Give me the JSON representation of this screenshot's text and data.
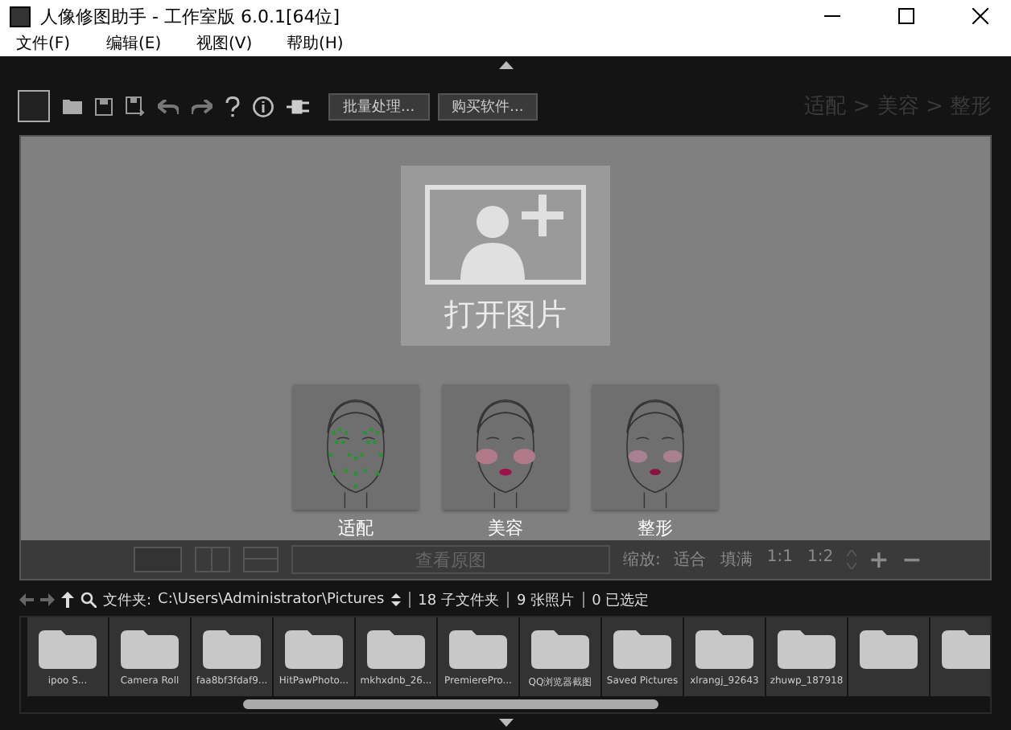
{
  "window": {
    "title": "人像修图助手 - 工作室版 6.0.1[64位]"
  },
  "menu": [
    "文件(F)",
    "编辑(E)",
    "视图(V)",
    "帮助(H)"
  ],
  "toolbar": {
    "buttons": [
      "批量处理...",
      "购买软件..."
    ],
    "breadcrumb": "适配 > 美容 > 整形"
  },
  "open_image": {
    "label": "打开图片"
  },
  "modes": [
    {
      "label": "适配",
      "kind": "landmarks"
    },
    {
      "label": "美容",
      "kind": "makeup"
    },
    {
      "label": "整形",
      "kind": "shape"
    }
  ],
  "view_bar": {
    "compare_button": "查看原图",
    "zoom_label": "缩放:",
    "zoom_options": [
      "适合",
      "填满",
      "1:1",
      "1:2"
    ],
    "zoom_in": "+",
    "zoom_out": "−"
  },
  "path_bar": {
    "folder_label": "文件夹:",
    "path": "C:\\Users\\Administrator\\Pictures",
    "subfolders": "18 子文件夹",
    "photos": "9 张照片",
    "selected": "0 已选定"
  },
  "folders": [
    {
      "kind": "folder",
      "label": "ipoo S..."
    },
    {
      "kind": "folder",
      "label": "Camera Roll"
    },
    {
      "kind": "folder",
      "label": "faa8bf3fdaf9..."
    },
    {
      "kind": "folder",
      "label": "HitPawPhoto..."
    },
    {
      "kind": "folder",
      "label": "mkhxdnb_26..."
    },
    {
      "kind": "folder",
      "label": "PremierePro..."
    },
    {
      "kind": "folder",
      "label": "QQ浏览器截图"
    },
    {
      "kind": "folder",
      "label": "Saved Pictures"
    },
    {
      "kind": "folder",
      "label": "xlrangj_92643"
    },
    {
      "kind": "folder",
      "label": "zhuwp_187918"
    },
    {
      "kind": "folder"
    },
    {
      "kind": "folder"
    }
  ]
}
